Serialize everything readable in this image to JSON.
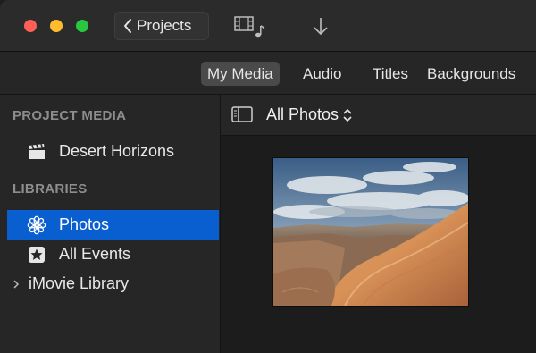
{
  "titlebar": {
    "back_label": "Projects",
    "icons": [
      "chevron-left-icon",
      "media-icon",
      "download-icon"
    ]
  },
  "tabs": [
    {
      "label": "My Media",
      "active": true
    },
    {
      "label": "Audio",
      "active": false
    },
    {
      "label": "Titles",
      "active": false
    },
    {
      "label": "Backgrounds",
      "active": false
    }
  ],
  "sidebar": {
    "project_media_header": "PROJECT MEDIA",
    "project_item": "Desert Horizons",
    "libraries_header": "LIBRARIES",
    "photos_item": "Photos",
    "events_item": "All Events",
    "library_item": "iMovie Library"
  },
  "browser": {
    "album_label": "All Photos"
  },
  "colors": {
    "selection": "#0a5fd0",
    "close": "#fe5f57",
    "minimize": "#febc2e",
    "zoom": "#28c840"
  }
}
